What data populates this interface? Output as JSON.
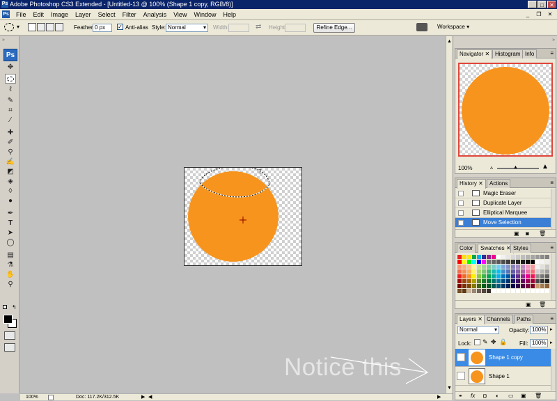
{
  "title_bar": {
    "title": "Adobe Photoshop CS3 Extended - [Untitled-13 @ 100% (Shape 1 copy, RGB/8)]",
    "app_icon": "Ps",
    "minimize": "_",
    "maximize": "□",
    "close": "✕"
  },
  "menu": {
    "app_icon": "Ps",
    "items": [
      "File",
      "Edit",
      "Image",
      "Layer",
      "Select",
      "Filter",
      "Analysis",
      "View",
      "Window",
      "Help"
    ],
    "mdi_minimize": "_",
    "mdi_restore": "❐",
    "mdi_close": "✕"
  },
  "options_bar": {
    "feather_label": "Feather:",
    "feather_value": "0 px",
    "antialias_label": "Anti-alias",
    "style_label": "Style:",
    "style_value": "Normal",
    "width_label": "Width:",
    "height_label": "Height:",
    "refine_edge": "Refine Edge...",
    "workspace": "Workspace ▾"
  },
  "toolbox": {
    "logo": "Ps"
  },
  "status_bar": {
    "zoom": "100%",
    "doc": "Doc: 117.2K/312.5K"
  },
  "annotation": {
    "text": "Notice this"
  },
  "navigator": {
    "tabs": [
      "Navigator",
      "Histogram",
      "Info"
    ],
    "zoom": "100%"
  },
  "history": {
    "tabs": [
      "History",
      "Actions"
    ],
    "items": [
      "Magic Eraser",
      "Duplicate Layer",
      "Elliptical Marquee",
      "Move Selection"
    ],
    "selected_index": 3
  },
  "swatches": {
    "tabs": [
      "Color",
      "Swatches",
      "Styles"
    ],
    "colors": [
      "#ed1c24",
      "#ffde00",
      "#f7ec13",
      "#00a651",
      "#00aeef",
      "#2e3192",
      "#92278f",
      "#ec008c",
      "#ffffff",
      "#f2f2f2",
      "#e6e6e6",
      "#d9d9d9",
      "#cccccc",
      "#bfbfbf",
      "#b3b3b3",
      "#a6a6a6",
      "#999999",
      "#8c8c8c",
      "#808080",
      "#ff0000",
      "#ffff00",
      "#00ff00",
      "#00ffff",
      "#0000ff",
      "#ff00ff",
      "#737373",
      "#666666",
      "#595959",
      "#4d4d4d",
      "#404040",
      "#333333",
      "#262626",
      "#1a1a1a",
      "#0d0d0d",
      "#000000",
      "#ffffff",
      "#f4f4f4",
      "#ececec",
      "#f7977a",
      "#f9ad81",
      "#fdc68a",
      "#fff79a",
      "#c4df9b",
      "#a3d39c",
      "#82ca9d",
      "#7bcdc8",
      "#6ecff6",
      "#7ea7d8",
      "#8493ca",
      "#8882be",
      "#a187be",
      "#bc8dbf",
      "#f49ac2",
      "#f6989d",
      "#f3f3f3",
      "#e0e0e0",
      "#c8c8c8",
      "#f26c4f",
      "#f68e56",
      "#fbaf5d",
      "#fff467",
      "#acd373",
      "#7cc576",
      "#3bb878",
      "#1abbb4",
      "#00bff3",
      "#438cca",
      "#5574b9",
      "#605ca8",
      "#855fa8",
      "#a763a8",
      "#f06eaa",
      "#f26d7d",
      "#d0d0d0",
      "#b8b8b8",
      "#a0a0a0",
      "#ed1c24",
      "#f26522",
      "#f7941d",
      "#fff200",
      "#8dc63f",
      "#39b54a",
      "#00a651",
      "#00a99d",
      "#00aeef",
      "#0072bc",
      "#0054a6",
      "#2e3192",
      "#662d91",
      "#92278f",
      "#ec008c",
      "#ed145b",
      "#909090",
      "#787878",
      "#606060",
      "#9e0b0f",
      "#a0410d",
      "#a36209",
      "#aba000",
      "#598527",
      "#1a7b30",
      "#007236",
      "#00746b",
      "#0076a3",
      "#004b80",
      "#003471",
      "#1b1464",
      "#440e62",
      "#630460",
      "#9e005d",
      "#9e0039",
      "#484848",
      "#303030",
      "#181818",
      "#790000",
      "#7b2e00",
      "#7d4900",
      "#827b00",
      "#406618",
      "#005e20",
      "#005826",
      "#005952",
      "#005b7f",
      "#003663",
      "#002157",
      "#0d004c",
      "#32004b",
      "#4b0049",
      "#7b0046",
      "#7a0026",
      "#c69c6d",
      "#a67c52",
      "#8c6239",
      "#754c24",
      "#603913",
      "#c7b299",
      "#998675",
      "#736357",
      "#534741",
      "#37302d",
      "#ffffff",
      "#ffffff",
      "#ffffff",
      "#ffffff",
      "#ffffff",
      "#ffffff",
      "#ffffff",
      "#ffffff",
      "#ffffff",
      "#ffffff",
      "#ffffff",
      "#ffffff"
    ]
  },
  "layers": {
    "tabs": [
      "Layers",
      "Channels",
      "Paths"
    ],
    "blend_mode": "Normal",
    "opacity_label": "Opacity:",
    "opacity_value": "100%",
    "lock_label": "Lock:",
    "fill_label": "Fill:",
    "fill_value": "100%",
    "items": [
      {
        "name": "Shape 1 copy",
        "visible": true,
        "selected": true
      },
      {
        "name": "Shape 1",
        "visible": false,
        "selected": false
      }
    ]
  },
  "colors": {
    "shape_fill": "#f7941d",
    "selection_highlight": "#3a8be6"
  }
}
